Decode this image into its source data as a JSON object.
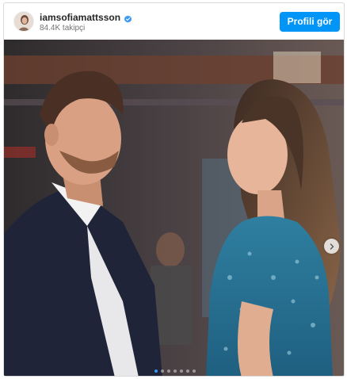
{
  "post": {
    "username": "iamsofiamattsson",
    "followers": "84.4K takipçi",
    "profile_button": "Profili gör",
    "verified": true,
    "carousel": {
      "total": 7,
      "active": 1
    }
  },
  "colors": {
    "accent": "#0095f6",
    "verified_badge": "#3897f0"
  },
  "icons": {
    "verified": "verified-badge-icon",
    "next": "chevron-right-icon"
  }
}
